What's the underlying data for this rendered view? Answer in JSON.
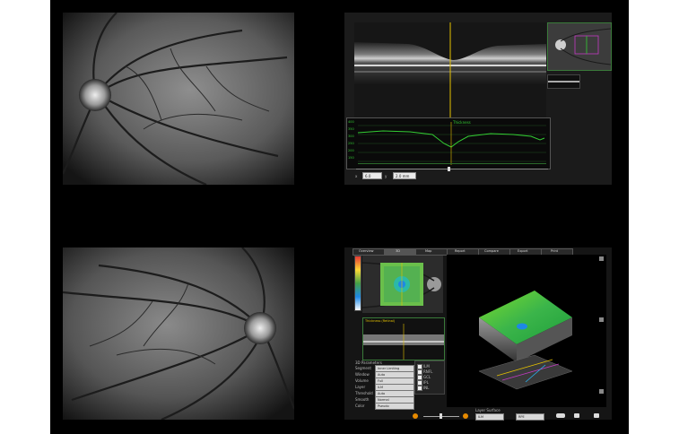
{
  "oct_header": {
    "title": "Tracing HD",
    "scan": "120/120",
    "mode": "Ultra Fine",
    "region": "Retinal",
    "intensity": "Intensity +5"
  },
  "thickness_graph": {
    "label": "Thickness",
    "y_ticks": [
      "400",
      "350",
      "300",
      "250",
      "200",
      "150"
    ]
  },
  "oct_controls": {
    "field1_value": "6.0",
    "field2_value": "2.0 mm"
  },
  "analysis_panel": {
    "tabs": [
      "Overview",
      "3D",
      "Map",
      "Report",
      "Compare",
      "Export",
      "Print"
    ],
    "oct_inset_label": "Thickness (Retinal)",
    "sidebar_labels": [
      "3D Parameters",
      "Segment",
      "Window",
      "Volume",
      "Layer",
      "Threshold",
      "Smooth",
      "Color"
    ],
    "sidebar_values": [
      "Retinal",
      "Inner Limiting",
      "Auto",
      "Full",
      "ILM",
      "Auto",
      "Normal",
      "Pseudo"
    ],
    "layer_options": [
      "ILM",
      "RNFL",
      "GCL",
      "IPL",
      "INL",
      "RPE"
    ],
    "bottom_label": "Layer Surface",
    "bottom_field1": "ILM",
    "bottom_field2": "RPE"
  },
  "colors": {
    "accent_green": "#33cc33",
    "highlight_yellow": "#e6c200",
    "map_blue": "#1e88e5",
    "background": "#000000"
  }
}
